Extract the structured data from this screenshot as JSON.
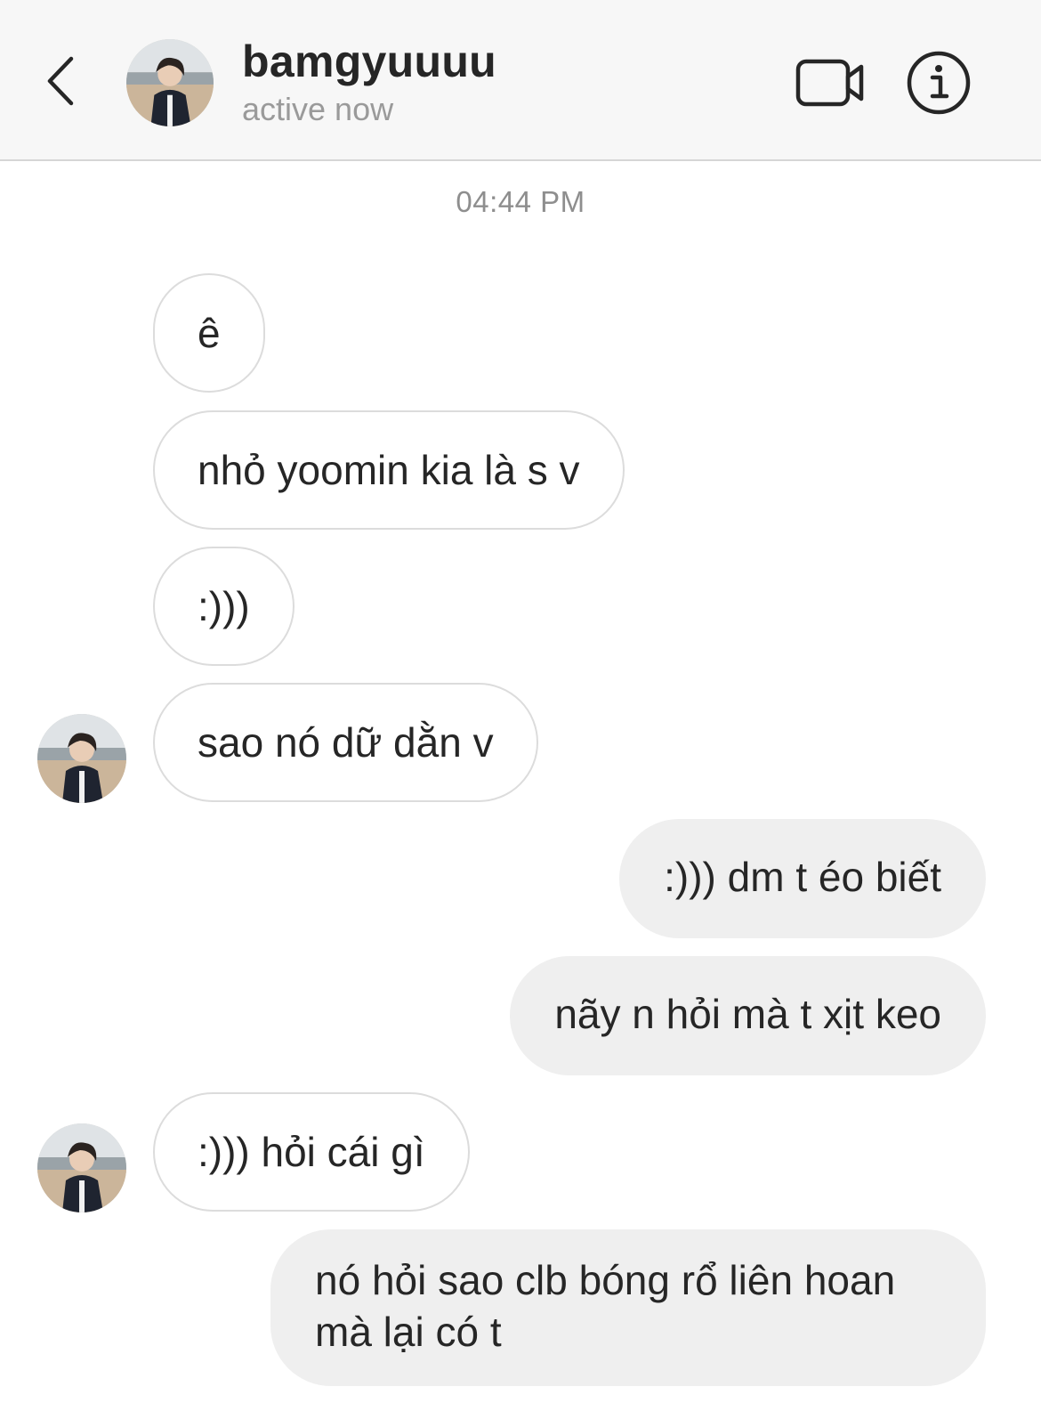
{
  "header": {
    "username": "bamgyuuuu",
    "status": "active now",
    "back_icon": "chevron-left-icon",
    "video_icon": "video-camera-icon",
    "info_icon": "info-icon"
  },
  "conversation": {
    "timestamp": "04:44 PM",
    "messages": [
      {
        "direction": "incoming",
        "text": "ê"
      },
      {
        "direction": "incoming",
        "text": "nhỏ yoomin kia là s v"
      },
      {
        "direction": "incoming",
        "text": ":)))"
      },
      {
        "direction": "incoming",
        "text": "sao nó dữ dằn v"
      },
      {
        "direction": "outgoing",
        "text": ":))) dm t éo biết"
      },
      {
        "direction": "outgoing",
        "text": "nãy n hỏi mà t xịt keo"
      },
      {
        "direction": "incoming",
        "text": ":))) hỏi cái gì"
      },
      {
        "direction": "outgoing",
        "text": "nó hỏi sao clb bóng rổ liên hoan mà lại có t"
      }
    ]
  },
  "colors": {
    "header_bg": "#f7f7f7",
    "incoming_border": "#dcdcdc",
    "outgoing_bg": "#efefef",
    "muted_text": "#8e8e8e"
  }
}
